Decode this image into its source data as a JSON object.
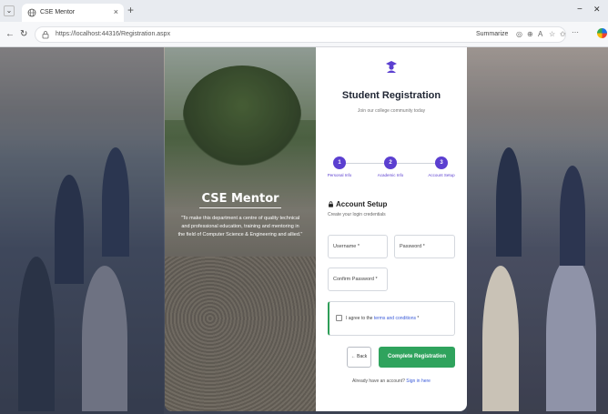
{
  "browser": {
    "tab_title": "CSE Mentor",
    "tab_close": "×",
    "new_tab": "+",
    "url": "https://localhost:44316/Registration.aspx",
    "summarize_label": "Summarize",
    "window_minimize": "−",
    "window_close": "✕",
    "nav_back": "←",
    "nav_reload": "↻"
  },
  "hero": {
    "title": "CSE Mentor",
    "description": "\"To make this department a centre of quality technical and professional education, training and mentoring in the field of Computer Science & Engineering and allied.\""
  },
  "registration": {
    "title": "Student Registration",
    "subtitle": "Join our college community today",
    "steps": [
      {
        "number": "1",
        "label": "Personal Info"
      },
      {
        "number": "2",
        "label": "Academic Info"
      },
      {
        "number": "3",
        "label": "Account Setup"
      }
    ],
    "section_title": "Account Setup",
    "section_subtitle": "Create your login credentials",
    "fields": {
      "username": "Username *",
      "password": "Password *",
      "confirm_password": "Confirm Password *"
    },
    "terms_prefix": "I agree to the",
    "terms_link": "terms and conditions",
    "terms_suffix": " *",
    "back_button": "← Back",
    "complete_button": "Complete Registration",
    "signin_prefix": "Already have an account?",
    "signin_link": "Sign in here"
  },
  "colors": {
    "accent": "#5b3fd0",
    "primary_button": "#2fa35d",
    "link": "#3a5bd9"
  }
}
